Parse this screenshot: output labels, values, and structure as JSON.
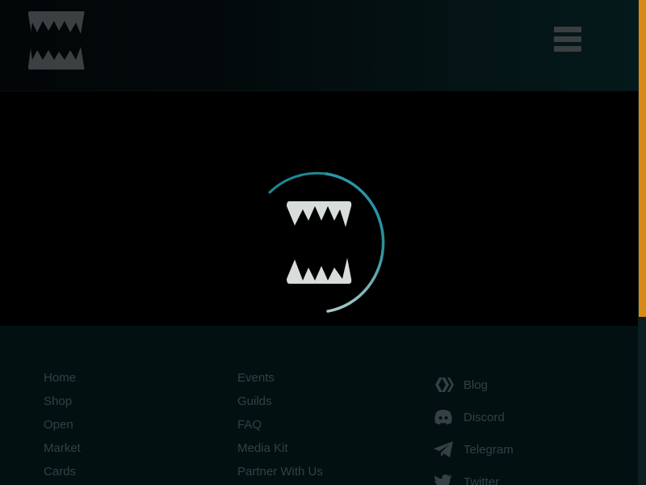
{
  "header": {
    "logo_icon": "fangs-logo-icon",
    "menu_icon": "hamburger-menu-icon"
  },
  "loader": {
    "icon": "fangs-spinner-icon",
    "ring_color": "#2a98a8"
  },
  "footer": {
    "column1": [
      {
        "label": "Home"
      },
      {
        "label": "Shop"
      },
      {
        "label": "Open"
      },
      {
        "label": "Market"
      },
      {
        "label": "Cards"
      }
    ],
    "column2": [
      {
        "label": "Events"
      },
      {
        "label": "Guilds"
      },
      {
        "label": "FAQ"
      },
      {
        "label": "Media Kit"
      },
      {
        "label": "Partner With Us"
      }
    ],
    "social": [
      {
        "label": "Blog",
        "icon": "hive-blog-icon"
      },
      {
        "label": "Discord",
        "icon": "discord-icon"
      },
      {
        "label": "Telegram",
        "icon": "telegram-icon"
      },
      {
        "label": "Twitter",
        "icon": "twitter-icon"
      }
    ]
  },
  "colors": {
    "accent_scrollbar": "#d88a14",
    "footer_text": "#344043",
    "footer_bg": "#021012"
  }
}
